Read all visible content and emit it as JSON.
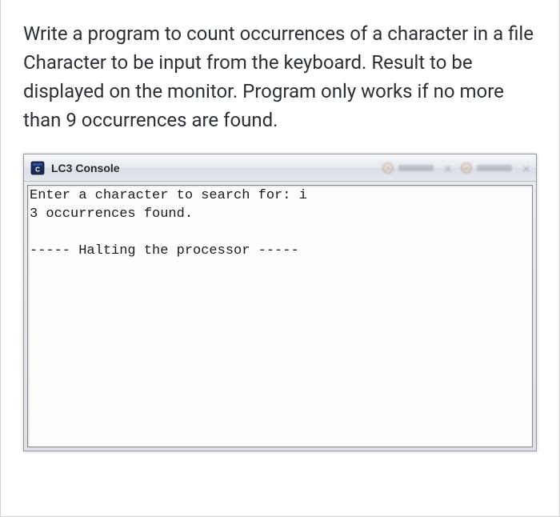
{
  "question": {
    "text": "Write a program to count occurrences of a character in a file  Character to be input from the keyboard. Result to be displayed on the monitor. Program only works if no more than 9 occurrences are found."
  },
  "console": {
    "title": "LC3 Console",
    "output": "Enter a character to search for: i\n3 occurrences found.\n\n----- Halting the processor -----"
  }
}
